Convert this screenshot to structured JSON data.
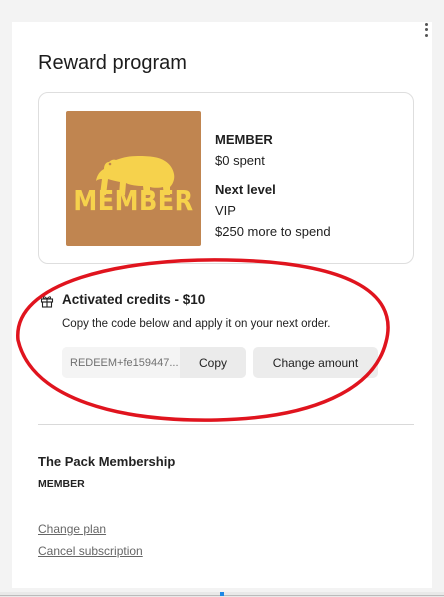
{
  "panel": {
    "title": "Reward program"
  },
  "tier_card": {
    "badge_text": "MEMBER",
    "badge_color": "#c08550",
    "badge_text_color": "#f6d24c",
    "current_tier": "MEMBER",
    "spent": "$0 spent",
    "next_level_label": "Next level",
    "next_level_value": "VIP",
    "remaining": "$250 more to spend"
  },
  "credits": {
    "icon": "gift-icon",
    "title": "Activated credits - $10",
    "subtitle": "Copy the code below and apply it on your next order.",
    "code_value": "REDEEM+fe159447...",
    "copy_label": "Copy",
    "change_amount_label": "Change amount",
    "annotation_color": "#e0141e"
  },
  "membership": {
    "title": "The Pack Membership",
    "tier": "MEMBER",
    "change_plan_label": "Change plan",
    "cancel_label": "Cancel subscription"
  }
}
